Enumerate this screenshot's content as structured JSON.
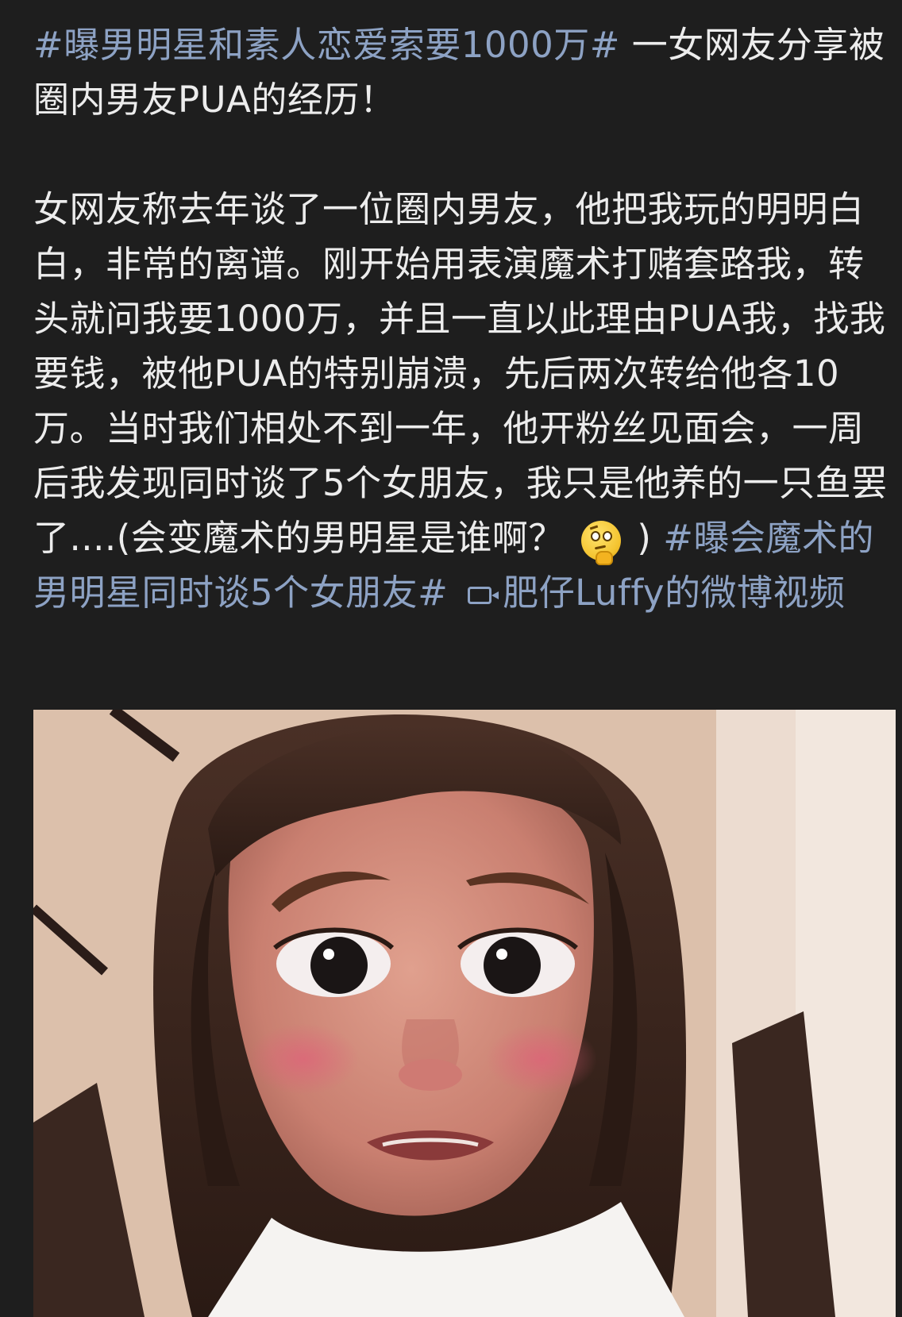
{
  "post": {
    "hashtag_1": "#曝男明星和素人恋爱索要1000万#",
    "intro": "一女网友分享被圈内男友PUA的经历！",
    "body": "女网友称去年谈了一位圈内男友，他把我玩的明明白白，非常的离谱。刚开始用表演魔术打赌套路我，转头就问我要1000万，并且一直以此理由PUA我，找我要钱，被他PUA的特别崩溃，先后两次转给他各10万。当时我们相处不到一年，他开粉丝见面会，一周后我发现同时谈了5个女朋友，我只是他养的一只鱼罢了....(会变魔术的男明星是谁啊？",
    "emoji": "thinking-face-emoji",
    "after_emoji": ")",
    "hashtag_2": "#曝会魔术的男明星同时谈5个女朋友#",
    "video_link_text": "肥仔Luffy的微博视频",
    "video_icon": "video-icon"
  },
  "colors": {
    "background": "#1e1e1e",
    "text": "#ececec",
    "link": "#8da2c4"
  },
  "video": {
    "thumbnail": "animated-girl-face-filter-video"
  }
}
